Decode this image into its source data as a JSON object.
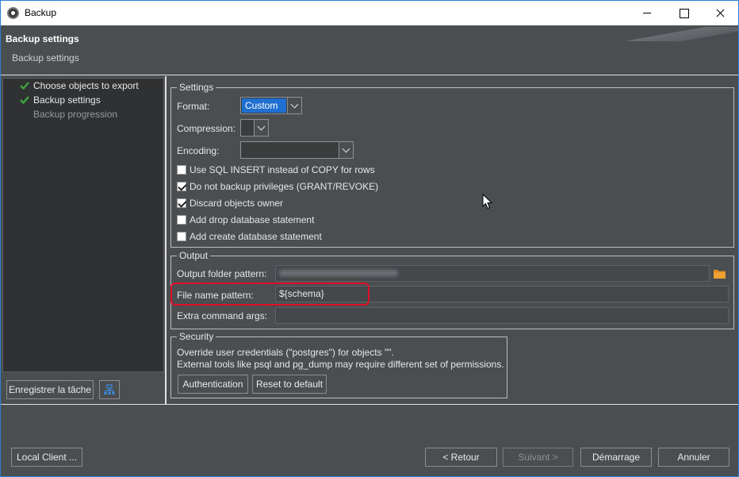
{
  "window": {
    "title": "Backup"
  },
  "header": {
    "title": "Backup settings",
    "subtitle": "Backup settings"
  },
  "nav": {
    "items": [
      {
        "label": "Choose objects to export",
        "done": true
      },
      {
        "label": "Backup settings",
        "done": true
      },
      {
        "label": "Backup progression",
        "done": false
      }
    ],
    "save_task_label": "Enregistrer la tâche"
  },
  "settings": {
    "group_title": "Settings",
    "format_label": "Format:",
    "format_value": "Custom",
    "compression_label": "Compression:",
    "compression_value": "",
    "encoding_label": "Encoding:",
    "encoding_value": "",
    "options": [
      {
        "label": "Use SQL INSERT instead of COPY for rows",
        "checked": false
      },
      {
        "label": "Do not backup privileges (GRANT/REVOKE)",
        "checked": true
      },
      {
        "label": "Discard objects owner",
        "checked": true
      },
      {
        "label": "Add drop database statement",
        "checked": false
      },
      {
        "label": "Add create database statement",
        "checked": false
      }
    ]
  },
  "output": {
    "group_title": "Output",
    "folder_label": "Output folder pattern:",
    "file_label": "File name pattern:",
    "file_value": "${schema}",
    "extra_label": "Extra command args:",
    "extra_value": ""
  },
  "security": {
    "group_title": "Security",
    "line1": "Override user credentials (\"postgres\") for objects \"\".",
    "line2": "External tools like psql and pg_dump may require different set of permissions.",
    "auth_label": "Authentication",
    "reset_label": "Reset to default"
  },
  "footer": {
    "local_client_label": "Local Client ...",
    "back_label": "< Retour",
    "next_label": "Suivant >",
    "start_label": "Démarrage",
    "cancel_label": "Annuler"
  },
  "colors": {
    "accent": "#1f6fd0",
    "highlight": "#e0102a",
    "check_green": "#3fa63f",
    "folder_orange": "#e08a1a"
  }
}
